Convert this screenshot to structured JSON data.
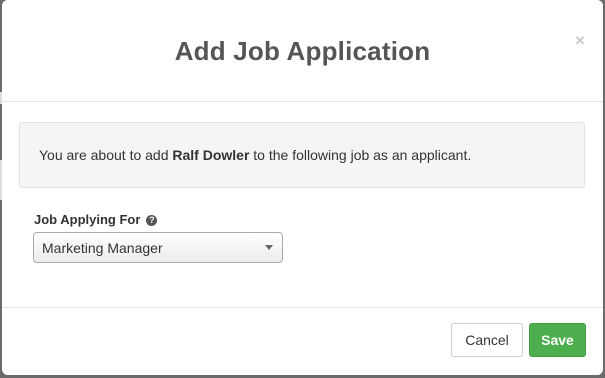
{
  "dialog": {
    "title": "Add Job Application",
    "close_glyph": "×"
  },
  "message": {
    "prefix": "You are about to add ",
    "applicant_name": "Ralf Dowler",
    "suffix": " to the following job as an applicant."
  },
  "job_field": {
    "label": "Job Applying For",
    "help_glyph": "?",
    "selected_value": "Marketing Manager"
  },
  "footer": {
    "cancel_label": "Cancel",
    "save_label": "Save"
  },
  "colors": {
    "save_button": "#4cae4c",
    "title_text": "#555555"
  }
}
